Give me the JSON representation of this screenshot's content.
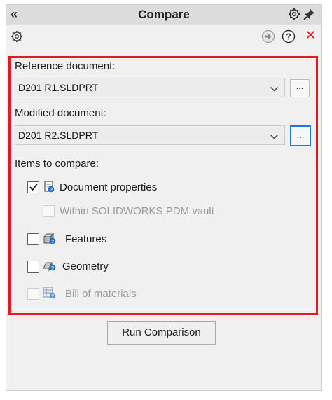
{
  "header": {
    "title": "Compare"
  },
  "reference": {
    "label": "Reference document:",
    "value": "D201 R1.SLDPRT",
    "browse_label": "..."
  },
  "modified": {
    "label": "Modified document:",
    "value": "D201 R2.SLDPRT",
    "browse_label": "..."
  },
  "items": {
    "label": "Items to compare:",
    "document_properties": {
      "label": "Document properties",
      "checked": true
    },
    "within_pdm": {
      "label": "Within SOLIDWORKS PDM vault",
      "checked": false,
      "enabled": false
    },
    "features": {
      "label": "Features",
      "checked": false
    },
    "geometry": {
      "label": "Geometry",
      "checked": false
    },
    "bom": {
      "label": "Bill of materials",
      "checked": false,
      "enabled": false
    }
  },
  "actions": {
    "run_label": "Run Comparison"
  },
  "colors": {
    "highlight_border": "#e01b24",
    "focus_border": "#1f7ad6",
    "close": "#dd1111"
  }
}
